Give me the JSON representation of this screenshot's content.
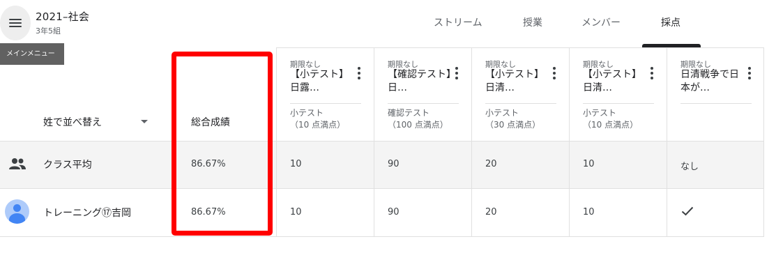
{
  "header": {
    "class_name": "2021–社会",
    "section": "3年5組",
    "menu_tooltip": "メインメニュー",
    "tabs": [
      {
        "label": "ストリーム"
      },
      {
        "label": "授業"
      },
      {
        "label": "メンバー"
      },
      {
        "label": "採点",
        "selected": true
      }
    ]
  },
  "grid": {
    "sort_label": "姓で並べ替え",
    "overall_label": "総合成績",
    "assignments": [
      {
        "due": "期限なし",
        "title": "【小テスト】日露…",
        "topic_line1": "小テスト",
        "topic_line2": "（10 点満点）"
      },
      {
        "due": "期限なし",
        "title": "【確認テスト】日…",
        "topic_line1": "確認テスト",
        "topic_line2": "（100 点満点）"
      },
      {
        "due": "期限なし",
        "title": "【小テスト】日清…",
        "topic_line1": "小テスト",
        "topic_line2": "（30 点満点）"
      },
      {
        "due": "期限なし",
        "title": "【小テスト】日清…",
        "topic_line1": "小テスト",
        "topic_line2": "（10 点満点）"
      },
      {
        "due": "期限なし",
        "title": "日清戦争で日本が…",
        "topic_line1": "",
        "topic_line2": ""
      }
    ],
    "rows": [
      {
        "name": "クラス平均",
        "icon": "people-icon",
        "overall": "86.67%",
        "grades": [
          "10",
          "90",
          "20",
          "10",
          "なし"
        ]
      },
      {
        "name": "トレーニング⑰吉岡",
        "icon": "avatar",
        "overall": "86.67%",
        "grades": [
          "10",
          "90",
          "20",
          "10",
          ""
        ],
        "last_status_icon": "check-icon"
      }
    ]
  },
  "colors": {
    "highlight_box": "#ff0000",
    "avatar_bg": "#aecbfa",
    "avatar_fg": "#4285f4",
    "average_row_bg": "#f4f4f4"
  }
}
